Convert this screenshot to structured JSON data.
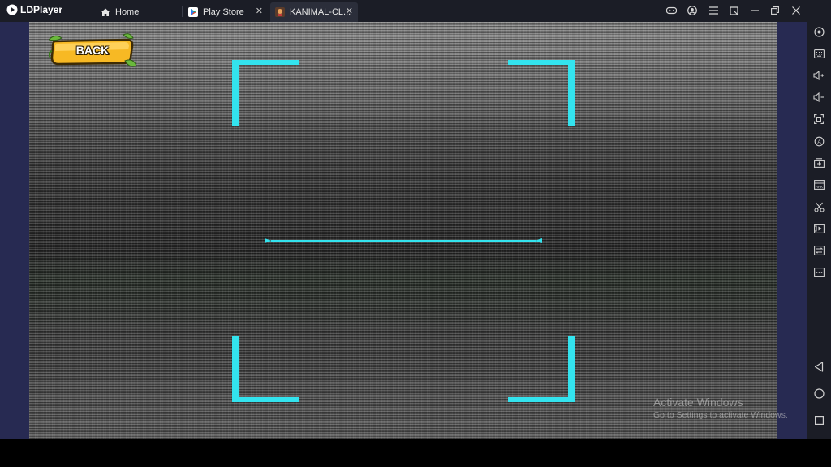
{
  "app": {
    "name": "LDPlayer"
  },
  "tabs": [
    {
      "label": "Home",
      "icon": "home-icon"
    },
    {
      "label": "Play Store",
      "icon": "play-store-icon",
      "closable": true
    },
    {
      "label": "KANIMAL-CL...",
      "icon": "kanimal-app-icon",
      "closable": true,
      "active": true
    }
  ],
  "window_controls": [
    "gamepad-icon",
    "account-icon",
    "menu-icon",
    "external-window-icon",
    "minimize-icon",
    "restore-icon",
    "close-icon"
  ],
  "sidebar": {
    "top_icons": [
      "settings-icon",
      "keyboard-icon",
      "volume-up-icon",
      "volume-down-icon",
      "screenshot-icon",
      "sync-icon",
      "add-screen-icon",
      "apk-install-icon",
      "scissors-icon",
      "video-record-icon",
      "file-transfer-icon",
      "more-icon"
    ],
    "bottom_icons": [
      "back-nav-icon",
      "home-nav-icon",
      "recents-nav-icon"
    ]
  },
  "game": {
    "back_label": "BACK"
  },
  "watermark": {
    "line1": "Activate Windows",
    "line2": "Go to Settings to activate Windows."
  },
  "colors": {
    "accent": "#33e3ee",
    "titlebar": "#1b1d26",
    "frame": "#272a52",
    "back_button": "#f7b924"
  }
}
